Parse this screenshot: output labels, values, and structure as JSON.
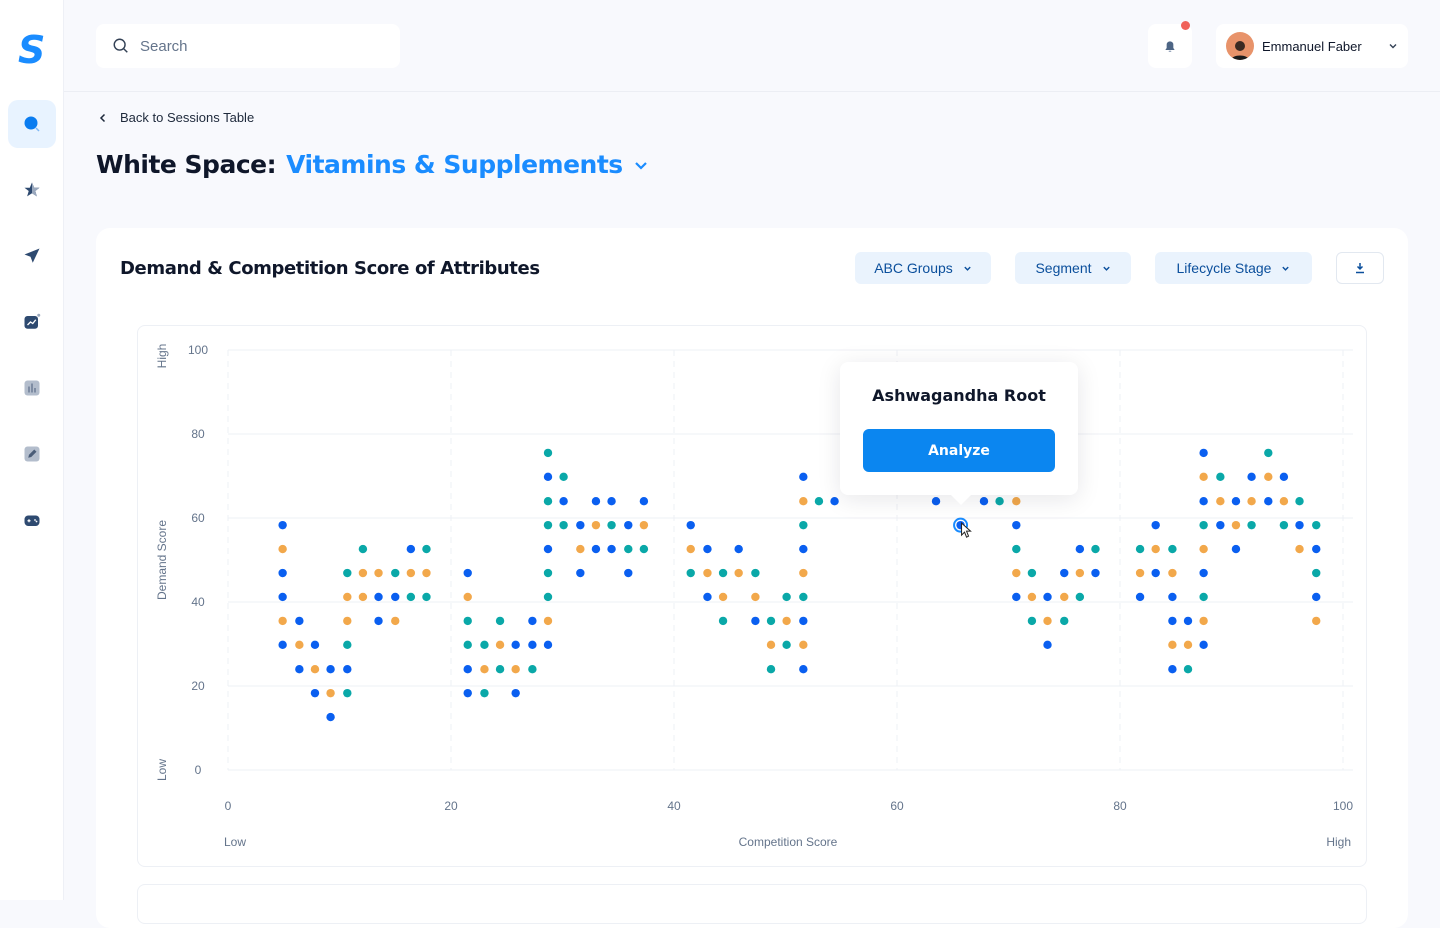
{
  "app": {
    "logo": "S"
  },
  "sidebar": {
    "items": [
      {
        "icon": "search-analytics-icon",
        "active": true
      },
      {
        "icon": "star-icon"
      },
      {
        "icon": "paper-plane-icon"
      },
      {
        "icon": "trend-chart-icon"
      },
      {
        "icon": "bar-chart-icon"
      },
      {
        "icon": "pencil-icon"
      },
      {
        "icon": "gamepad-icon"
      }
    ]
  },
  "header": {
    "search_placeholder": "Search",
    "notifications": {
      "icon": "bell-icon",
      "has_unread": true
    },
    "user": {
      "name": "Emmanuel Faber"
    }
  },
  "breadcrumb": {
    "back_label": "Back to Sessions Table"
  },
  "page": {
    "title_prefix": "White Space:",
    "title_category": "Vitamins & Supplements"
  },
  "card": {
    "title": "Demand & Competition Score of Attributes",
    "filters": [
      "ABC Groups",
      "Segment",
      "Lifecycle Stage"
    ],
    "download_icon": "download-icon"
  },
  "tooltip": {
    "title": "Ashwagandha Root",
    "button": "Analyze"
  },
  "colors": {
    "accent": "#1a8cff",
    "groups": [
      "#0a5ff0",
      "#f2a84b",
      "#0aa8a8"
    ]
  },
  "chart_data": {
    "type": "scatter",
    "xlabel": "Competition Score",
    "ylabel": "Demand Score",
    "x_low_label": "Low",
    "x_high_label": "High",
    "y_low_label": "Low",
    "y_high_label": "High",
    "xlim": [
      0,
      100
    ],
    "ylim": [
      0,
      100
    ],
    "xticks": [
      0,
      20,
      40,
      60,
      80,
      100
    ],
    "yticks": [
      0,
      20,
      40,
      60,
      80,
      100
    ],
    "grid": true,
    "highlighted_point": [
      65.7,
      58.3
    ],
    "points": [
      [
        4.9,
        58.3,
        0
      ],
      [
        4.9,
        52.6,
        1
      ],
      [
        12.1,
        52.6,
        2
      ],
      [
        16.4,
        52.6,
        0
      ],
      [
        17.8,
        52.6,
        2
      ],
      [
        4.9,
        46.9,
        0
      ],
      [
        10.7,
        46.9,
        2
      ],
      [
        12.1,
        46.9,
        1
      ],
      [
        13.5,
        46.9,
        1
      ],
      [
        15.0,
        46.9,
        2
      ],
      [
        16.4,
        46.9,
        1
      ],
      [
        17.8,
        46.9,
        1
      ],
      [
        4.9,
        41.2,
        0
      ],
      [
        10.7,
        41.2,
        1
      ],
      [
        12.1,
        41.2,
        1
      ],
      [
        13.5,
        41.2,
        0
      ],
      [
        15.0,
        41.2,
        0
      ],
      [
        16.4,
        41.2,
        2
      ],
      [
        17.8,
        41.2,
        2
      ],
      [
        4.9,
        35.5,
        1
      ],
      [
        6.4,
        35.5,
        0
      ],
      [
        10.7,
        35.5,
        1
      ],
      [
        13.5,
        35.5,
        0
      ],
      [
        15.0,
        35.5,
        1
      ],
      [
        4.9,
        29.8,
        0
      ],
      [
        6.4,
        29.8,
        1
      ],
      [
        7.8,
        29.8,
        0
      ],
      [
        10.7,
        29.8,
        2
      ],
      [
        6.4,
        24.0,
        0
      ],
      [
        7.8,
        24.0,
        1
      ],
      [
        9.2,
        24.0,
        0
      ],
      [
        10.7,
        24.0,
        0
      ],
      [
        7.8,
        18.3,
        0
      ],
      [
        9.2,
        18.3,
        1
      ],
      [
        10.7,
        18.3,
        2
      ],
      [
        9.2,
        12.6,
        0
      ],
      [
        28.7,
        75.5,
        2
      ],
      [
        28.7,
        69.8,
        0
      ],
      [
        30.1,
        69.8,
        2
      ],
      [
        28.7,
        64.0,
        2
      ],
      [
        30.1,
        64.0,
        0
      ],
      [
        33.0,
        64.0,
        0
      ],
      [
        34.4,
        64.0,
        0
      ],
      [
        37.3,
        64.0,
        0
      ],
      [
        28.7,
        58.3,
        2
      ],
      [
        30.1,
        58.3,
        2
      ],
      [
        31.6,
        58.3,
        0
      ],
      [
        33.0,
        58.3,
        1
      ],
      [
        34.4,
        58.3,
        2
      ],
      [
        35.9,
        58.3,
        0
      ],
      [
        37.3,
        58.3,
        1
      ],
      [
        28.7,
        52.6,
        0
      ],
      [
        31.6,
        52.6,
        1
      ],
      [
        33.0,
        52.6,
        0
      ],
      [
        34.4,
        52.6,
        0
      ],
      [
        35.9,
        52.6,
        2
      ],
      [
        37.3,
        52.6,
        2
      ],
      [
        21.5,
        46.9,
        0
      ],
      [
        28.7,
        46.9,
        2
      ],
      [
        31.6,
        46.9,
        0
      ],
      [
        35.9,
        46.9,
        0
      ],
      [
        21.5,
        41.2,
        1
      ],
      [
        28.7,
        41.2,
        2
      ],
      [
        21.5,
        35.5,
        2
      ],
      [
        24.4,
        35.5,
        2
      ],
      [
        27.3,
        35.5,
        0
      ],
      [
        28.7,
        35.5,
        1
      ],
      [
        21.5,
        29.8,
        2
      ],
      [
        23.0,
        29.8,
        2
      ],
      [
        24.4,
        29.8,
        1
      ],
      [
        25.8,
        29.8,
        0
      ],
      [
        27.3,
        29.8,
        0
      ],
      [
        28.7,
        29.8,
        0
      ],
      [
        21.5,
        24.0,
        0
      ],
      [
        23.0,
        24.0,
        1
      ],
      [
        24.4,
        24.0,
        2
      ],
      [
        25.8,
        24.0,
        1
      ],
      [
        27.3,
        24.0,
        2
      ],
      [
        21.5,
        18.3,
        0
      ],
      [
        23.0,
        18.3,
        2
      ],
      [
        25.8,
        18.3,
        0
      ],
      [
        51.6,
        69.8,
        0
      ],
      [
        51.6,
        64.0,
        1
      ],
      [
        53.0,
        64.0,
        2
      ],
      [
        54.4,
        64.0,
        0
      ],
      [
        41.5,
        58.3,
        0
      ],
      [
        51.6,
        58.3,
        2
      ],
      [
        41.5,
        52.6,
        1
      ],
      [
        43.0,
        52.6,
        0
      ],
      [
        45.8,
        52.6,
        0
      ],
      [
        51.6,
        52.6,
        0
      ],
      [
        41.5,
        46.9,
        2
      ],
      [
        43.0,
        46.9,
        1
      ],
      [
        44.4,
        46.9,
        2
      ],
      [
        45.8,
        46.9,
        1
      ],
      [
        47.3,
        46.9,
        2
      ],
      [
        51.6,
        46.9,
        1
      ],
      [
        43.0,
        41.2,
        0
      ],
      [
        44.4,
        41.2,
        1
      ],
      [
        47.3,
        41.2,
        1
      ],
      [
        50.1,
        41.2,
        2
      ],
      [
        51.6,
        41.2,
        2
      ],
      [
        44.4,
        35.5,
        2
      ],
      [
        47.3,
        35.5,
        0
      ],
      [
        48.7,
        35.5,
        2
      ],
      [
        50.1,
        35.5,
        1
      ],
      [
        51.6,
        35.5,
        0
      ],
      [
        48.7,
        29.8,
        1
      ],
      [
        50.1,
        29.8,
        2
      ],
      [
        51.6,
        29.8,
        1
      ],
      [
        48.7,
        24.0,
        2
      ],
      [
        51.6,
        24.0,
        0
      ],
      [
        63.5,
        64.0,
        0
      ],
      [
        67.8,
        64.0,
        0
      ],
      [
        69.2,
        64.0,
        2
      ],
      [
        70.7,
        64.0,
        1
      ],
      [
        65.7,
        58.3,
        0
      ],
      [
        70.7,
        58.3,
        0
      ],
      [
        70.7,
        52.6,
        2
      ],
      [
        76.4,
        52.6,
        0
      ],
      [
        77.8,
        52.6,
        2
      ],
      [
        70.7,
        46.9,
        1
      ],
      [
        72.1,
        46.9,
        2
      ],
      [
        75.0,
        46.9,
        0
      ],
      [
        76.4,
        46.9,
        1
      ],
      [
        77.8,
        46.9,
        0
      ],
      [
        70.7,
        41.2,
        0
      ],
      [
        72.1,
        41.2,
        1
      ],
      [
        73.5,
        41.2,
        0
      ],
      [
        75.0,
        41.2,
        1
      ],
      [
        76.4,
        41.2,
        2
      ],
      [
        72.1,
        35.5,
        2
      ],
      [
        73.5,
        35.5,
        1
      ],
      [
        75.0,
        35.5,
        2
      ],
      [
        73.5,
        29.8,
        0
      ],
      [
        87.5,
        75.5,
        0
      ],
      [
        93.3,
        75.5,
        2
      ],
      [
        87.5,
        69.8,
        1
      ],
      [
        89.0,
        69.8,
        2
      ],
      [
        91.8,
        69.8,
        0
      ],
      [
        93.3,
        69.8,
        1
      ],
      [
        94.7,
        69.8,
        0
      ],
      [
        87.5,
        64.0,
        0
      ],
      [
        89.0,
        64.0,
        1
      ],
      [
        90.4,
        64.0,
        0
      ],
      [
        91.8,
        64.0,
        1
      ],
      [
        93.3,
        64.0,
        0
      ],
      [
        94.7,
        64.0,
        1
      ],
      [
        96.1,
        64.0,
        2
      ],
      [
        83.2,
        58.3,
        0
      ],
      [
        87.5,
        58.3,
        2
      ],
      [
        89.0,
        58.3,
        0
      ],
      [
        90.4,
        58.3,
        1
      ],
      [
        91.8,
        58.3,
        2
      ],
      [
        94.7,
        58.3,
        2
      ],
      [
        96.1,
        58.3,
        0
      ],
      [
        97.6,
        58.3,
        2
      ],
      [
        81.8,
        52.6,
        2
      ],
      [
        83.2,
        52.6,
        1
      ],
      [
        84.7,
        52.6,
        2
      ],
      [
        87.5,
        52.6,
        1
      ],
      [
        90.4,
        52.6,
        0
      ],
      [
        96.1,
        52.6,
        1
      ],
      [
        97.6,
        52.6,
        0
      ],
      [
        81.8,
        46.9,
        1
      ],
      [
        83.2,
        46.9,
        0
      ],
      [
        84.7,
        46.9,
        1
      ],
      [
        87.5,
        46.9,
        0
      ],
      [
        97.6,
        46.9,
        2
      ],
      [
        81.8,
        41.2,
        0
      ],
      [
        84.7,
        41.2,
        0
      ],
      [
        87.5,
        41.2,
        2
      ],
      [
        97.6,
        41.2,
        0
      ],
      [
        84.7,
        35.5,
        0
      ],
      [
        86.1,
        35.5,
        0
      ],
      [
        87.5,
        35.5,
        1
      ],
      [
        97.6,
        35.5,
        1
      ],
      [
        84.7,
        29.8,
        1
      ],
      [
        86.1,
        29.8,
        1
      ],
      [
        87.5,
        29.8,
        0
      ],
      [
        84.7,
        24.0,
        0
      ],
      [
        86.1,
        24.0,
        2
      ]
    ]
  }
}
